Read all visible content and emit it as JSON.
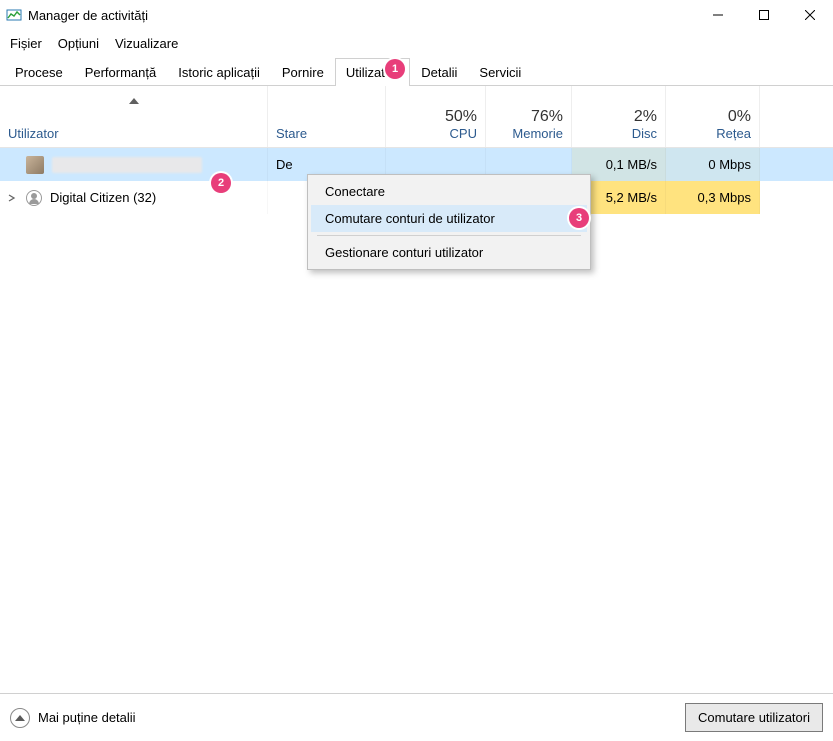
{
  "window": {
    "title": "Manager de activități"
  },
  "menu": {
    "file": "Fișier",
    "options": "Opțiuni",
    "view": "Vizualizare"
  },
  "tabs": {
    "processes": "Procese",
    "performance": "Performanță",
    "app_history": "Istoric aplicații",
    "startup": "Pornire",
    "users": "Utilizatori",
    "details": "Detalii",
    "services": "Servicii",
    "active": "users"
  },
  "columns": {
    "user": "Utilizator",
    "state": "Stare",
    "cpu_pct": "50%",
    "cpu": "CPU",
    "mem_pct": "76%",
    "mem": "Memorie",
    "disc_pct": "2%",
    "disc": "Disc",
    "net_pct": "0%",
    "net": "Rețea"
  },
  "rows": [
    {
      "user": "",
      "redacted": true,
      "state": "De",
      "cpu": "",
      "mem": "",
      "disc": "0,1 MB/s",
      "net": "0 Mbps",
      "selected": true
    },
    {
      "user": "Digital Citizen (32)",
      "redacted": false,
      "state": "",
      "cpu": "",
      "mem": "",
      "disc": "5,2 MB/s",
      "net": "0,3 Mbps",
      "selected": false
    }
  ],
  "context_menu": {
    "connect": "Conectare",
    "switch": "Comutare conturi de utilizator",
    "manage": "Gestionare conturi utilizator"
  },
  "bottom": {
    "fewer_details": "Mai puține detalii",
    "switch_users": "Comutare utilizatori"
  },
  "annotations": {
    "1": "1",
    "2": "2",
    "3": "3"
  }
}
